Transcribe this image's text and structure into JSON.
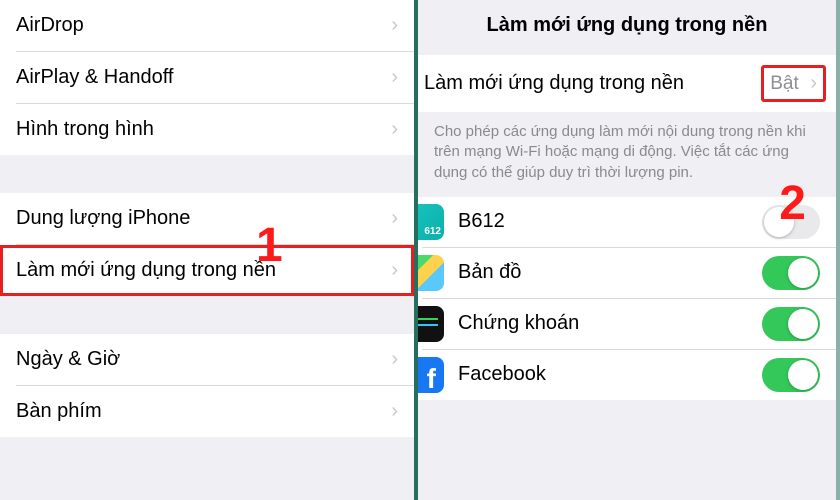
{
  "annotations": {
    "marker1": "1",
    "marker2": "2"
  },
  "left": {
    "group1": {
      "airdrop": "AirDrop",
      "airplay": "AirPlay & Handoff",
      "pip": "Hình trong hình"
    },
    "group2": {
      "storage": "Dung lượng iPhone",
      "refresh": "Làm mới ứng dụng trong nền"
    },
    "group3": {
      "datetime": "Ngày & Giờ",
      "keyboard": "Bàn phím"
    }
  },
  "right": {
    "title": "Làm mới ứng dụng trong nền",
    "master": {
      "label": "Làm mới ứng dụng trong nền",
      "value": "Bật"
    },
    "footer": "Cho phép các ứng dụng làm mới nội dung trong nền khi trên mạng Wi-Fi hoặc mạng di động. Việc tắt các ứng dụng có thể giúp duy trì thời lượng pin.",
    "apps": {
      "b612": {
        "label": "B612",
        "on": false
      },
      "maps": {
        "label": "Bản đồ",
        "on": true
      },
      "stocks": {
        "label": "Chứng khoán",
        "on": true
      },
      "fb": {
        "label": "Facebook",
        "on": true
      }
    }
  },
  "chevron": "›"
}
